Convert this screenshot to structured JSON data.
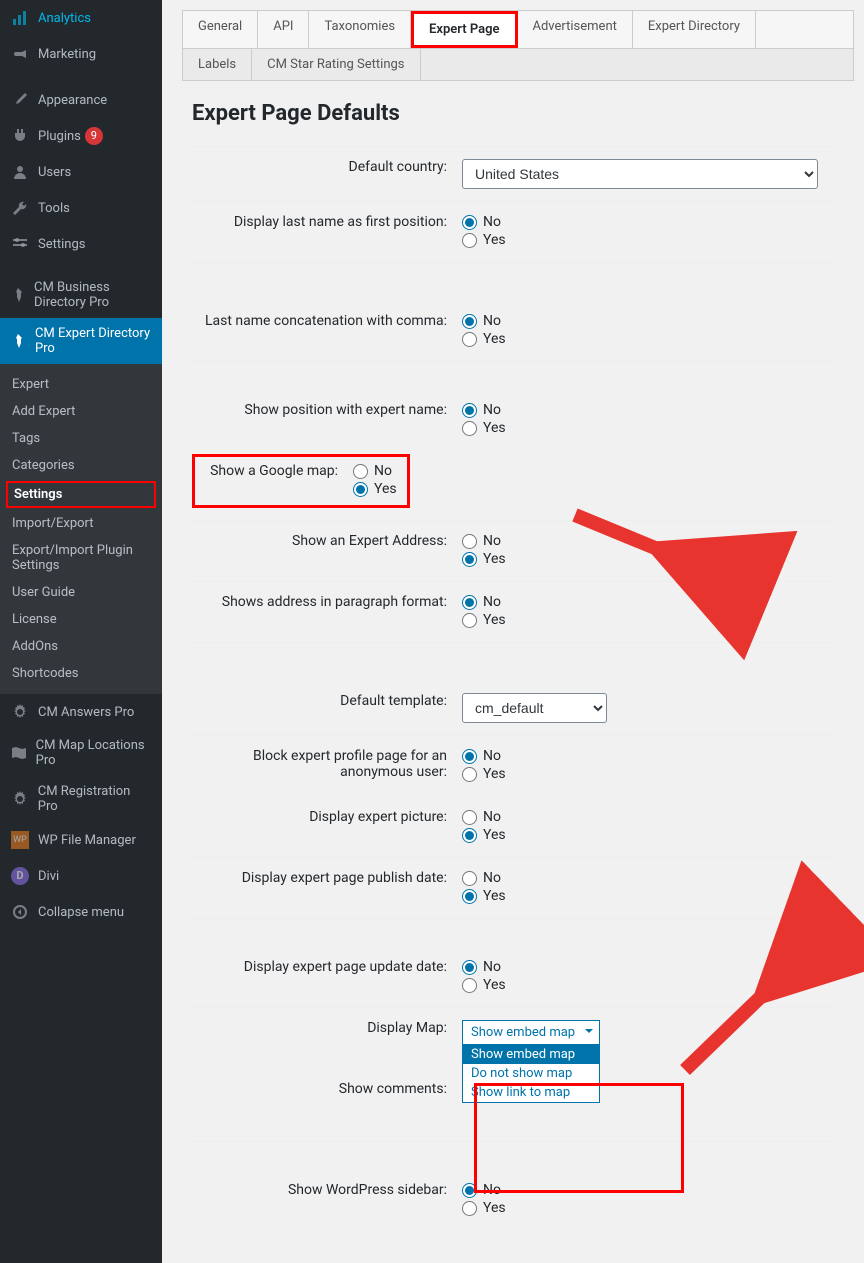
{
  "sidebar": {
    "analytics": "Analytics",
    "marketing": "Marketing",
    "appearance": "Appearance",
    "plugins": "Plugins",
    "plugins_badge": "9",
    "users": "Users",
    "tools": "Tools",
    "settings": "Settings",
    "cm_business": "CM Business Directory Pro",
    "cm_expert": "CM Expert Directory Pro",
    "sub": {
      "expert": "Expert",
      "add_expert": "Add Expert",
      "tags": "Tags",
      "categories": "Categories",
      "settings": "Settings",
      "import_export": "Import/Export",
      "export_import_plugin": "Export/Import Plugin Settings",
      "user_guide": "User Guide",
      "license": "License",
      "addons": "AddOns",
      "shortcodes": "Shortcodes"
    },
    "cm_answers": "CM Answers Pro",
    "cm_map": "CM Map Locations Pro",
    "cm_reg": "CM Registration Pro",
    "wp_file": "WP File Manager",
    "divi": "Divi",
    "divi_badge": "D",
    "wp_badge": "WP",
    "collapse": "Collapse menu"
  },
  "tabs": {
    "general": "General",
    "api": "API",
    "taxonomies": "Taxonomies",
    "expert_page": "Expert Page",
    "advertisement": "Advertisement",
    "expert_directory": "Expert Directory",
    "labels": "Labels",
    "cm_star": "CM Star Rating Settings"
  },
  "page": {
    "title": "Expert Page Defaults",
    "default_country_label": "Default country:",
    "default_country_value": "United States",
    "fields": {
      "last_name_first": "Display last name as first position:",
      "last_name_comma": "Last name concatenation with comma:",
      "show_position": "Show position with expert name:",
      "show_google_map": "Show a Google map:",
      "show_expert_address": "Show an Expert Address:",
      "address_paragraph": "Shows address in paragraph format:",
      "default_template": "Default template:",
      "default_template_value": "cm_default",
      "block_anon": "Block expert profile page for an anonymous user:",
      "display_picture": "Display expert picture:",
      "publish_date": "Display expert page publish date:",
      "update_date": "Display expert page update date:",
      "display_map": "Display Map:",
      "show_comments": "Show comments:",
      "show_sidebar": "Show WordPress sidebar:"
    },
    "radio": {
      "no": "No",
      "yes": "Yes"
    },
    "dropdown": {
      "selected": "Show embed map",
      "opt1": "Show embed map",
      "opt2": "Do not show map",
      "opt3": "Show link to map"
    }
  }
}
